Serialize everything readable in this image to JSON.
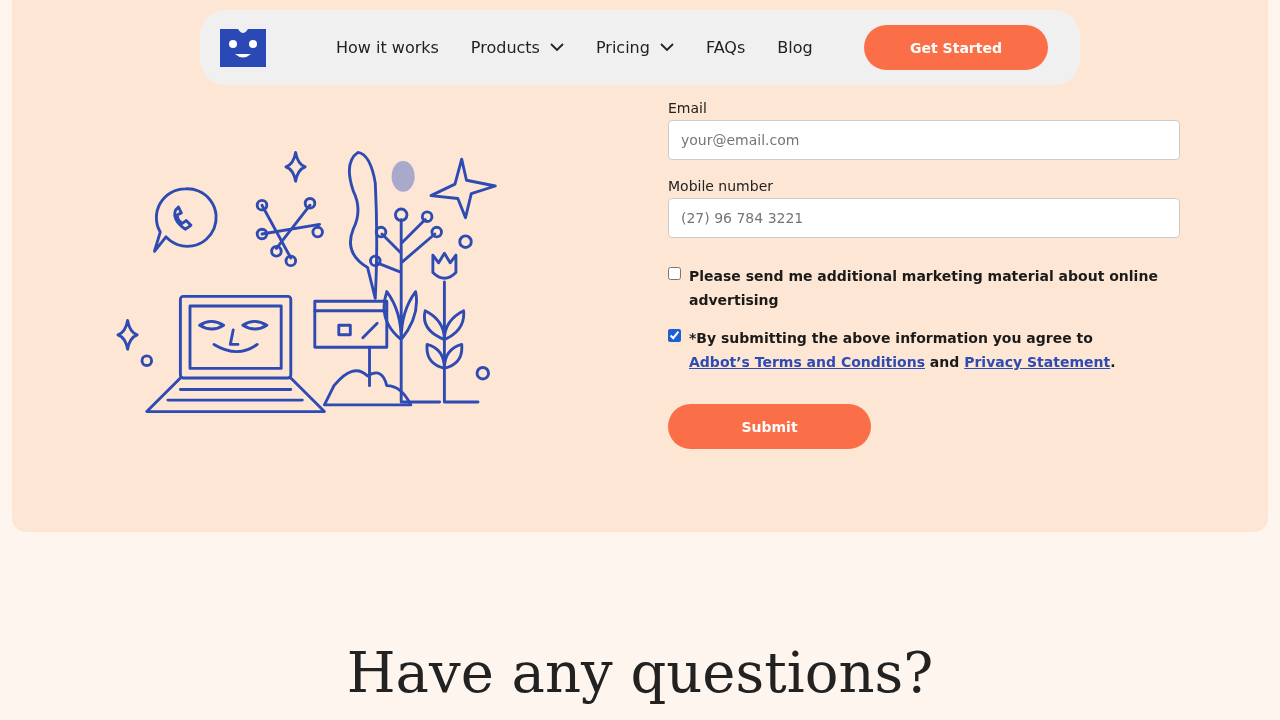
{
  "nav": {
    "links": [
      {
        "label": "How it works",
        "dropdown": false
      },
      {
        "label": "Products",
        "dropdown": true
      },
      {
        "label": "Pricing",
        "dropdown": true
      },
      {
        "label": "FAQs",
        "dropdown": false
      },
      {
        "label": "Blog",
        "dropdown": false
      }
    ],
    "cta": "Get Started"
  },
  "form": {
    "fields": [
      {
        "label": "Email",
        "placeholder": "your@email.com"
      },
      {
        "label": "Mobile number",
        "placeholder": "(27) 96 784 3221"
      }
    ],
    "consents": [
      {
        "checked": false,
        "parts": [
          {
            "text": "Please send me additional marketing material about online advertising",
            "link": false
          }
        ]
      },
      {
        "checked": true,
        "parts": [
          {
            "text": "*By submitting the above information you agree to ",
            "link": false
          },
          {
            "text": "Adbot’s Terms and Conditions",
            "link": true
          },
          {
            "text": " and ",
            "link": false
          },
          {
            "text": "Privacy Statement",
            "link": true
          },
          {
            "text": ".",
            "link": false
          }
        ]
      }
    ],
    "submit": "Submit"
  },
  "faq": {
    "heading": "Have any questions?"
  }
}
